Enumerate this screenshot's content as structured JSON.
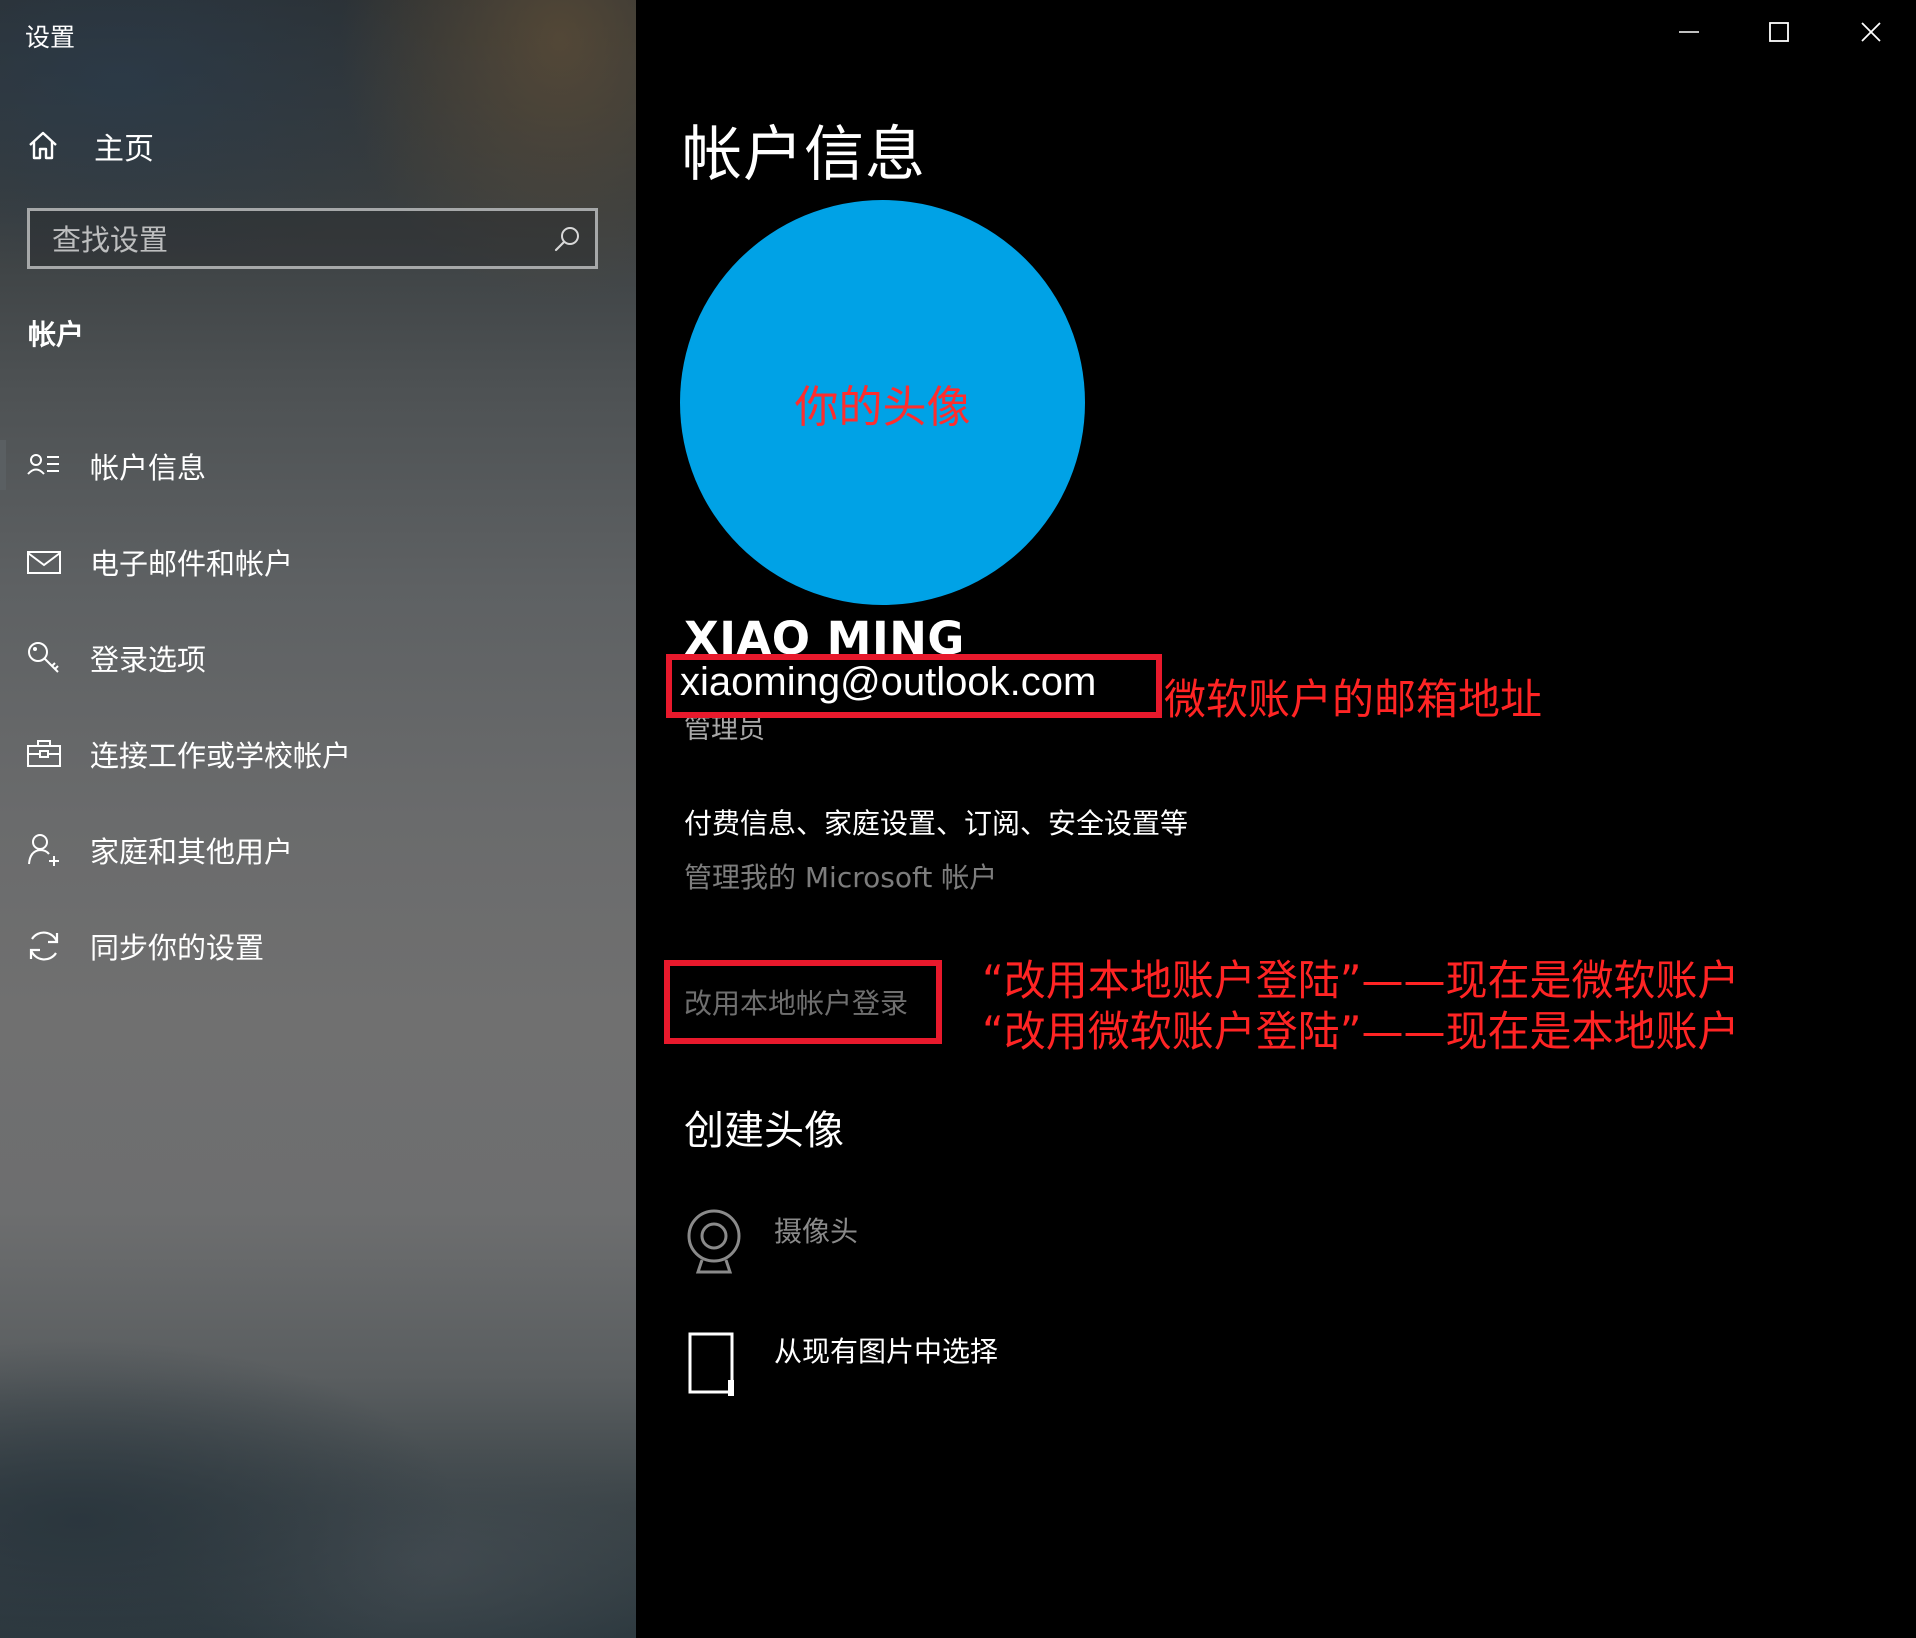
{
  "window": {
    "title": "设置",
    "minimize_icon": "minimize-icon",
    "maximize_icon": "maximize-icon",
    "close_icon": "close-icon"
  },
  "sidebar": {
    "home_label": "主页",
    "search": {
      "placeholder": "查找设置",
      "value": ""
    },
    "section_heading": "帐户",
    "items": [
      {
        "label": "帐户信息",
        "icon": "account-info-icon",
        "selected": true
      },
      {
        "label": "电子邮件和帐户",
        "icon": "mail-icon",
        "selected": false
      },
      {
        "label": "登录选项",
        "icon": "key-icon",
        "selected": false
      },
      {
        "label": "连接工作或学校帐户",
        "icon": "briefcase-icon",
        "selected": false
      },
      {
        "label": "家庭和其他用户",
        "icon": "add-user-icon",
        "selected": false
      },
      {
        "label": "同步你的设置",
        "icon": "sync-icon",
        "selected": false
      }
    ]
  },
  "main": {
    "page_title": "帐户信息",
    "avatar": {
      "label": "你的头像",
      "color": "#00a2e6"
    },
    "user": {
      "name": "XIAO MING",
      "email": "xiaoming@outlook.com",
      "role": "管理员"
    },
    "manage": {
      "heading": "付费信息、家庭设置、订阅、安全设置等",
      "link": "管理我的 Microsoft 帐户"
    },
    "switch_account_link": "改用本地帐户登录",
    "create_avatar": {
      "heading": "创建头像",
      "camera_label": "摄像头",
      "browse_label": "从现有图片中选择"
    }
  },
  "annotations": {
    "email_note": "微软账户的邮箱地址",
    "local_note_line1": "“改用本地账户登陆”——现在是微软账户",
    "local_note_line2": "“改用微软账户登陆”——现在是本地账户",
    "highlight_color": "#e8192c"
  }
}
